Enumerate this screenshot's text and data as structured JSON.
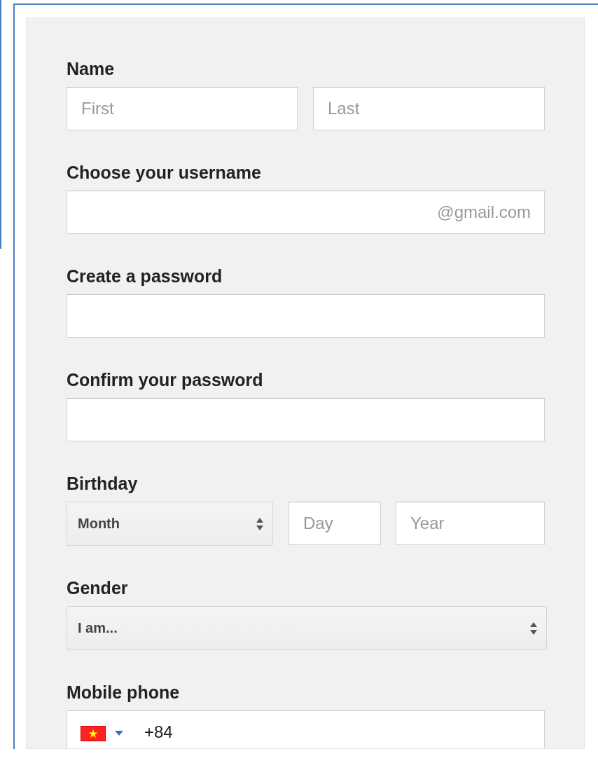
{
  "sections": [
    {
      "kind": "name",
      "label": "Name",
      "first": {
        "placeholder": "First"
      },
      "last": {
        "placeholder": "Last"
      }
    },
    {
      "kind": "username",
      "label": "Choose your username",
      "suffix": "@gmail.com"
    },
    {
      "kind": "password",
      "label": "Create a password"
    },
    {
      "kind": "password",
      "label": "Confirm your password"
    },
    {
      "kind": "birthday",
      "label": "Birthday",
      "month": {
        "value": "Month"
      },
      "day": {
        "placeholder": "Day"
      },
      "year": {
        "placeholder": "Year"
      }
    },
    {
      "kind": "select",
      "label": "Gender",
      "value": "I am..."
    },
    {
      "kind": "phone",
      "label": "Mobile phone",
      "value": "+84"
    }
  ]
}
